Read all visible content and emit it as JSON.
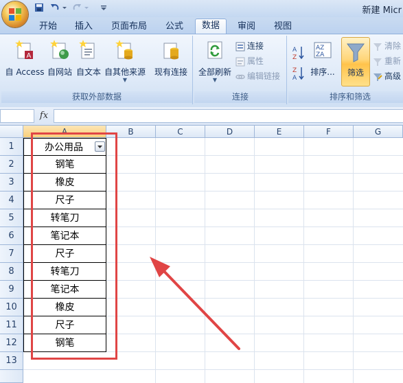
{
  "window": {
    "title": "新建 Micr"
  },
  "tabs": [
    {
      "label": "开始"
    },
    {
      "label": "插入"
    },
    {
      "label": "页面布局"
    },
    {
      "label": "公式"
    },
    {
      "label": "数据",
      "active": true
    },
    {
      "label": "审阅"
    },
    {
      "label": "视图"
    }
  ],
  "ribbon": {
    "get_external": {
      "access": "自 Access",
      "web": "自网站",
      "text": "自文本",
      "other": "自其他来源",
      "existing": "现有连接",
      "group_label": "获取外部数据"
    },
    "connections": {
      "refresh_all": "全部刷新",
      "connections": "连接",
      "properties": "属性",
      "edit_links": "编辑链接",
      "group_label": "连接"
    },
    "sort_filter": {
      "sort": "排序...",
      "filter": "筛选",
      "clear": "清除",
      "reapply": "重新",
      "advanced": "高级",
      "group_label": "排序和筛选"
    }
  },
  "formula_bar": {
    "fx": "fx",
    "value": ""
  },
  "sheet": {
    "columns": [
      "A",
      "B",
      "C",
      "D",
      "E",
      "F",
      "G"
    ],
    "rows": [
      "1",
      "2",
      "3",
      "4",
      "5",
      "6",
      "7",
      "8",
      "9",
      "10",
      "11",
      "12",
      "13"
    ],
    "column_a": [
      "办公用品",
      "钢笔",
      "橡皮",
      "尺子",
      "转笔刀",
      "笔记本",
      "尺子",
      "转笔刀",
      "笔记本",
      "橡皮",
      "尺子",
      "钢笔"
    ]
  },
  "colors": {
    "highlight": "#e04545",
    "accent": "#ffc34b",
    "ribbon": "#dfeaf8"
  }
}
